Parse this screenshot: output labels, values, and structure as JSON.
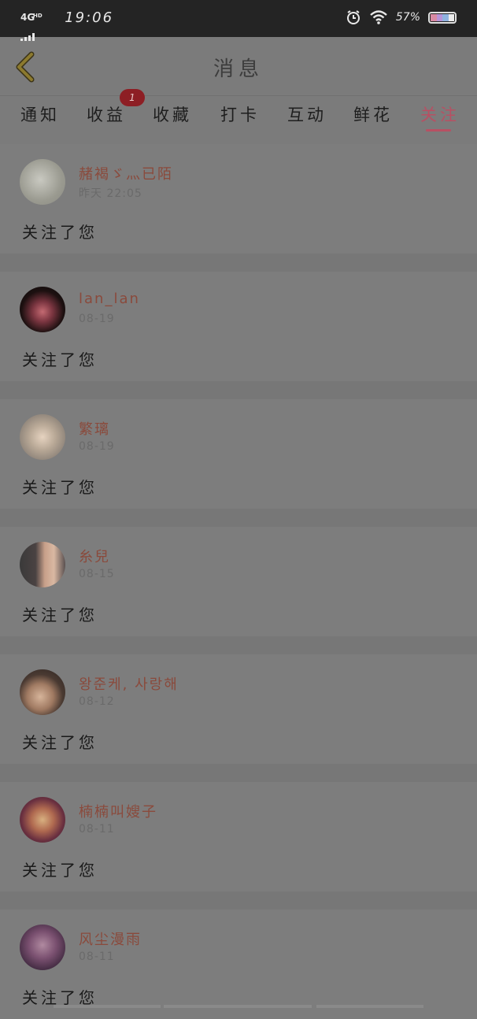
{
  "status_bar": {
    "network": "4G",
    "network_hd": "HD",
    "time": "19:06",
    "battery_percent": "57%",
    "icons": [
      "alarm-icon",
      "wifi-icon",
      "battery-icon"
    ]
  },
  "header": {
    "title": "消息",
    "back_icon": "back-chevron-icon"
  },
  "tabs": [
    {
      "label": "通知"
    },
    {
      "label": "收益"
    },
    {
      "label": "收藏"
    },
    {
      "label": "打卡"
    },
    {
      "label": "互动"
    },
    {
      "label": "鲜花"
    },
    {
      "label": "关注"
    }
  ],
  "active_tab": "关注",
  "badge": {
    "count": "1"
  },
  "colors": {
    "accent": "#b75063",
    "badge": "#8d1e24",
    "name": "#8a4a3c"
  },
  "follows": [
    {
      "name": "赭褐ゞ灬已陌",
      "date": "昨天 22:05",
      "message": "关注了您"
    },
    {
      "name": "lan_lan",
      "date": "08-19",
      "message": "关注了您"
    },
    {
      "name": "繁璃",
      "date": "08-19",
      "message": "关注了您"
    },
    {
      "name": "糸兒",
      "date": "08-15",
      "message": "关注了您"
    },
    {
      "name": "왕준케, 사랑해",
      "date": "08-12",
      "message": "关注了您"
    },
    {
      "name": "楠楠叫嫂子",
      "date": "08-11",
      "message": "关注了您"
    },
    {
      "name": "风尘漫雨",
      "date": "08-11",
      "message": "关注了您"
    }
  ]
}
